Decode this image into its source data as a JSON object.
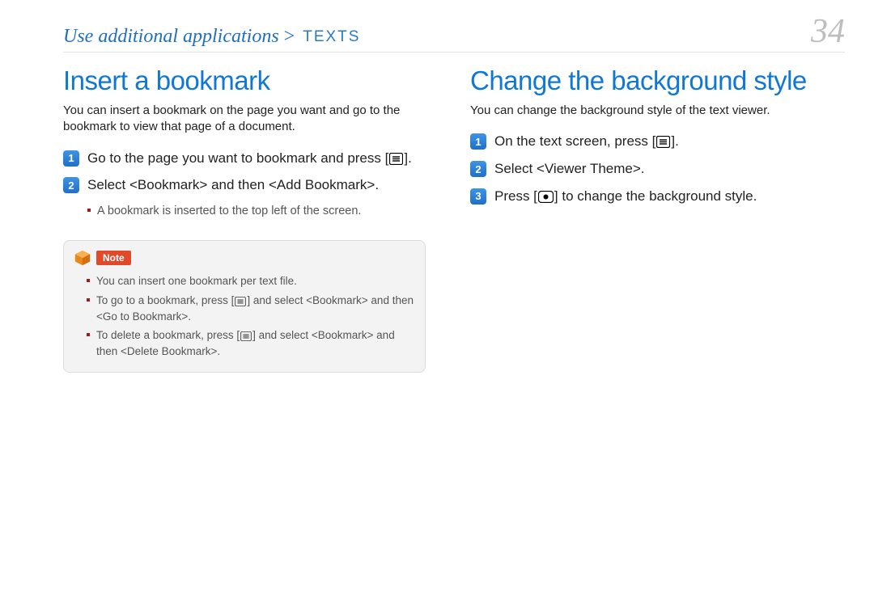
{
  "header": {
    "breadcrumb_main": "Use additional applications",
    "breadcrumb_sep": ">",
    "breadcrumb_current": "TEXTS",
    "page_number": "34"
  },
  "left": {
    "title": "Insert a bookmark",
    "intro": "You can insert a bookmark on the page you want and go to the bookmark to view that page of a document.",
    "steps": [
      {
        "num": "1",
        "pre": "Go to the page you want to bookmark and press [",
        "post": "]."
      },
      {
        "num": "2",
        "text": "Select <Bookmark> and then <Add Bookmark>."
      }
    ],
    "sub_bullet": "A bookmark is inserted to the top left of the screen.",
    "note_label": "Note",
    "note_items": [
      {
        "text": "You can insert one bookmark per text file."
      },
      {
        "pre": "To go to a bookmark, press [",
        "post": "] and select <Bookmark> and then <Go to Bookmark>."
      },
      {
        "pre": "To delete a bookmark, press [",
        "post": "] and select <Bookmark> and then <Delete Bookmark>."
      }
    ]
  },
  "right": {
    "title": "Change the background style",
    "intro": "You can change the background style of the text viewer.",
    "steps": [
      {
        "num": "1",
        "pre": "On the text screen, press [",
        "post": "]."
      },
      {
        "num": "2",
        "text": "Select <Viewer Theme>."
      },
      {
        "num": "3",
        "pre": "Press [",
        "post": "] to change the background style."
      }
    ]
  }
}
